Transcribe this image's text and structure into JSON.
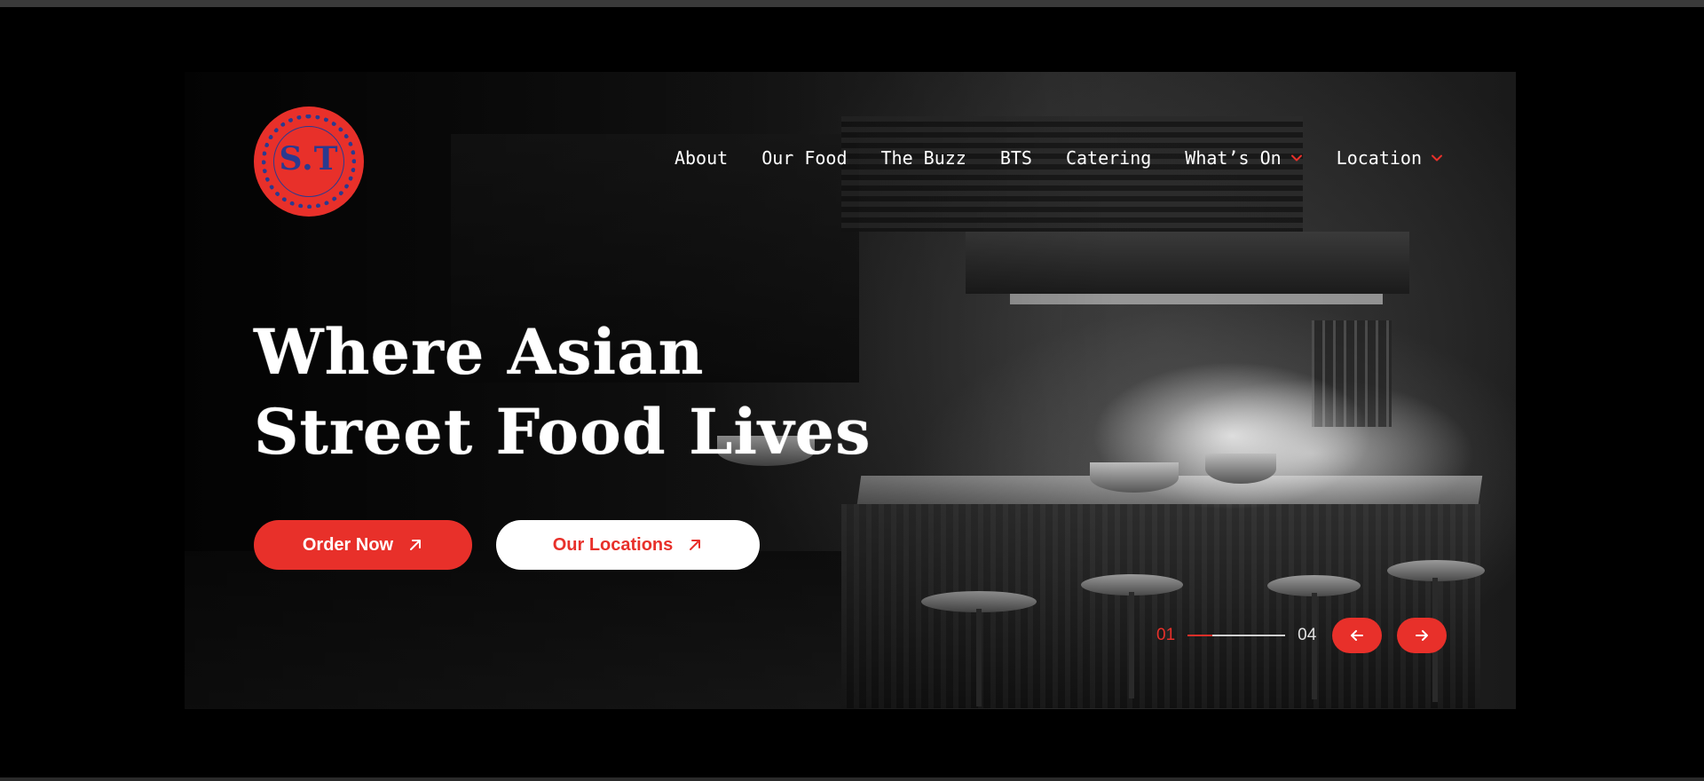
{
  "logo": {
    "monogram": "S.T",
    "brand_color": "#e8302a",
    "ink_color": "#2b3a8f"
  },
  "nav": {
    "items": [
      {
        "label": "About"
      },
      {
        "label": "Our Food"
      },
      {
        "label": "The Buzz"
      },
      {
        "label": "BTS"
      },
      {
        "label": "Catering"
      },
      {
        "label": "What’s On",
        "icon": "chevron-down-icon"
      },
      {
        "label": "Location",
        "icon": "chevron-down-icon"
      }
    ]
  },
  "hero": {
    "headline_line1": "Where Asian",
    "headline_line2": "Street Food Lives"
  },
  "buttons": {
    "order": {
      "label": "Order Now",
      "icon": "arrow-up-right-icon"
    },
    "locations": {
      "label": "Our Locations",
      "icon": "arrow-up-right-icon"
    }
  },
  "slider": {
    "current": "01",
    "total": "04",
    "progress_fraction": 0.25,
    "prev_icon": "arrow-left-icon",
    "next_icon": "arrow-right-icon"
  },
  "colors": {
    "accent": "#e8302a",
    "background": "#000000",
    "text": "#ffffff"
  }
}
